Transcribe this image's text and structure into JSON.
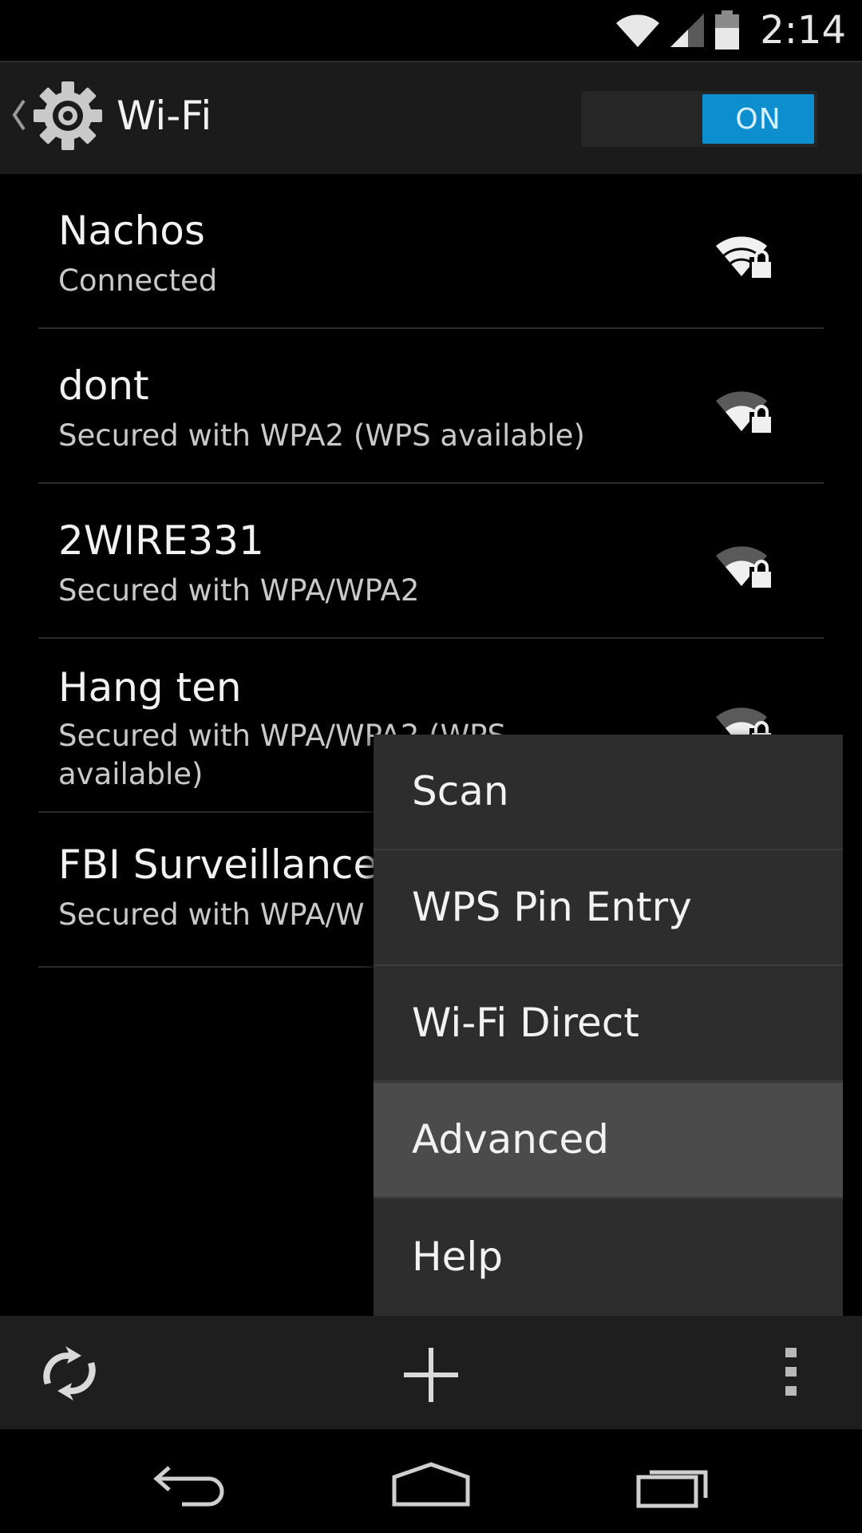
{
  "status_bar": {
    "time": "2:14"
  },
  "header": {
    "title": "Wi-Fi",
    "toggle_label": "ON"
  },
  "networks": [
    {
      "name": "Nachos",
      "status": "Connected"
    },
    {
      "name": "dont",
      "status": "Secured with WPA2 (WPS available)"
    },
    {
      "name": "2WIRE331",
      "status": "Secured with WPA/WPA2"
    },
    {
      "name": "Hang ten",
      "status": "Secured with WPA/WPA2 (WPS",
      "status_line2": "available)"
    },
    {
      "name": "FBI Surveillance",
      "status": "Secured with WPA/W"
    }
  ],
  "menu": {
    "items": [
      {
        "label": "Scan"
      },
      {
        "label": "WPS Pin Entry"
      },
      {
        "label": "Wi-Fi Direct"
      },
      {
        "label": "Advanced"
      },
      {
        "label": "Help"
      }
    ],
    "highlighted_item": "Advanced"
  },
  "bottom_bar": {
    "icons": [
      "wps-push-icon",
      "add-network-icon",
      "overflow-menu-icon"
    ]
  },
  "nav_bar": {
    "icons": [
      "back-icon",
      "home-icon",
      "recents-icon"
    ]
  },
  "colors": {
    "accent": "#0d8fcf",
    "menu_bg": "#2d2d2d",
    "menu_highlight": "#4b4b4b",
    "action_bar_bg": "#1b1b1b"
  }
}
